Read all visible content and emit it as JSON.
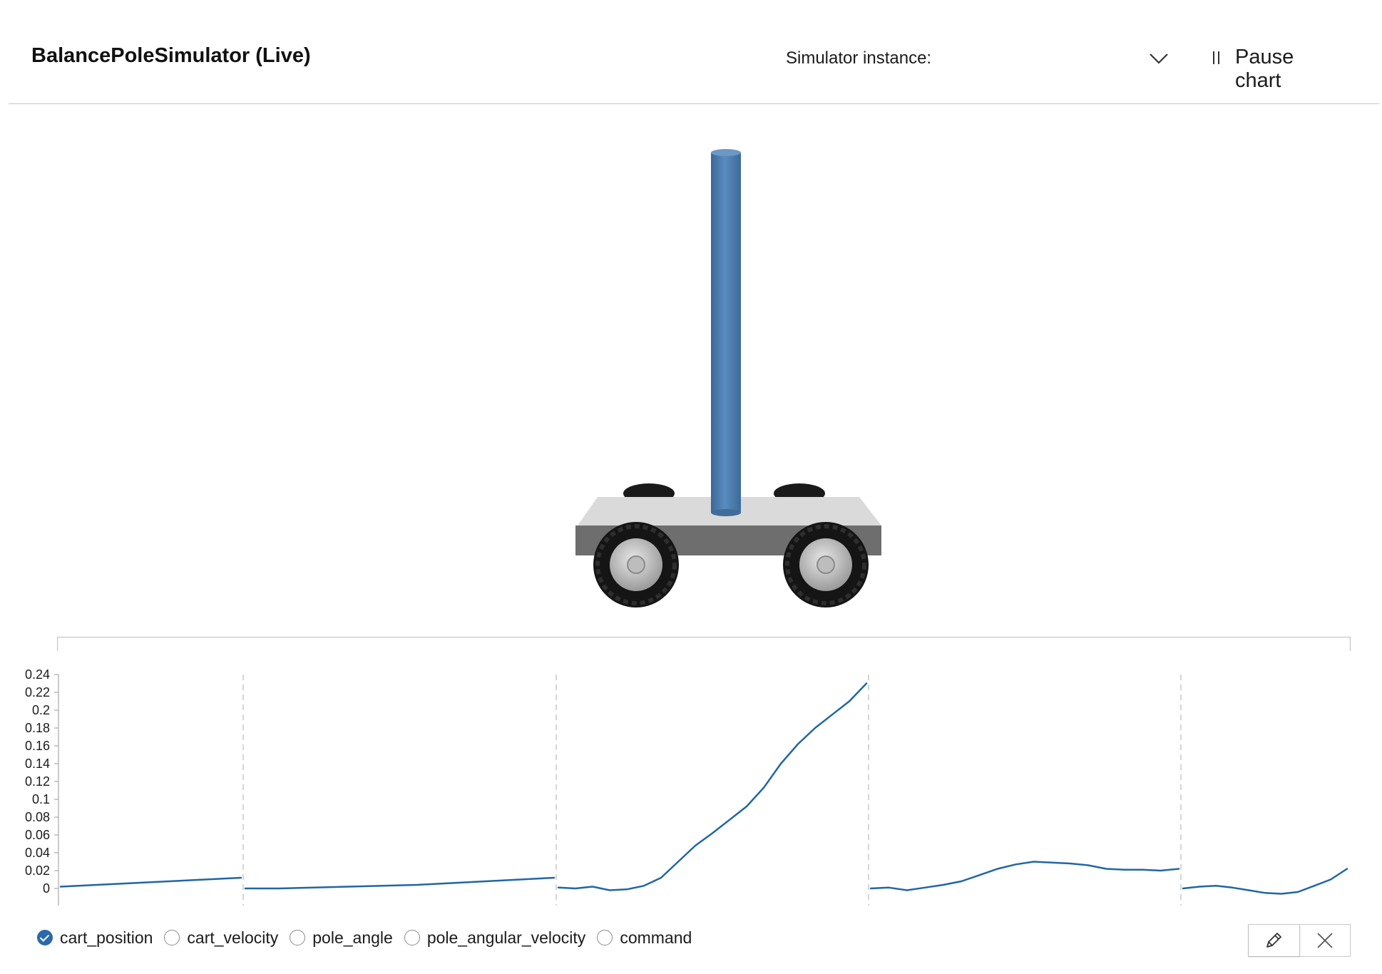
{
  "header": {
    "title": "BalancePoleSimulator (Live)",
    "simulator_instance_label": "Simulator instance:",
    "simulator_instance_value": "",
    "pause_label": "Pause chart"
  },
  "colors": {
    "accent": "#2a6aa8",
    "line": "#2166a5",
    "pole": "#4f7eb0",
    "cart_top": "#d9d9d9",
    "cart_side": "#707070",
    "divider": "#c8c8c8"
  },
  "icons": {
    "dropdown": "chevron-down-icon",
    "pause": "pause-icon",
    "edit": "pencil-icon",
    "close": "close-icon"
  },
  "legend": {
    "items": [
      {
        "label": "cart_position",
        "checked": true
      },
      {
        "label": "cart_velocity",
        "checked": false
      },
      {
        "label": "pole_angle",
        "checked": false
      },
      {
        "label": "pole_angular_velocity",
        "checked": false
      },
      {
        "label": "command",
        "checked": false
      }
    ]
  },
  "chart_data": {
    "type": "line",
    "title": "",
    "xlabel": "",
    "ylabel": "",
    "ylim": [
      0,
      0.24
    ],
    "y_ticks": [
      "0.24",
      "0.22",
      "0.2",
      "0.18",
      "0.16",
      "0.14",
      "0.12",
      "0.1",
      "0.08",
      "0.06",
      "0.04",
      "0.02",
      "0"
    ],
    "episode_dividers": true,
    "grid": false,
    "series": [
      {
        "episodes": [
          {
            "y": [
              0.002,
              0.004,
              0.006,
              0.008,
              0.01,
              0.012
            ]
          },
          {
            "y": [
              0.0,
              0.0,
              0.001,
              0.002,
              0.003,
              0.004,
              0.006,
              0.008,
              0.01,
              0.012
            ]
          },
          {
            "y": [
              0.001,
              0.0,
              0.002,
              -0.002,
              -0.001,
              0.003,
              0.012,
              0.03,
              0.048,
              0.062,
              0.077,
              0.092,
              0.113,
              0.14,
              0.162,
              0.18,
              0.195,
              0.21,
              0.23
            ]
          },
          {
            "y": [
              0.0,
              0.001,
              -0.002,
              0.001,
              0.004,
              0.008,
              0.015,
              0.022,
              0.027,
              0.03,
              0.029,
              0.028,
              0.026,
              0.022,
              0.021,
              0.021,
              0.02,
              0.022
            ]
          },
          {
            "y": [
              0.0,
              0.002,
              0.003,
              0.001,
              -0.002,
              -0.005,
              -0.006,
              -0.004,
              0.003,
              0.01,
              0.022
            ]
          }
        ]
      }
    ]
  }
}
